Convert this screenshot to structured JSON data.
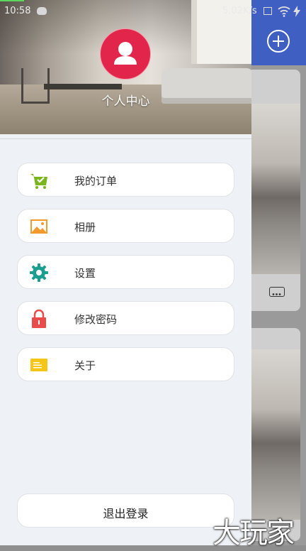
{
  "status_bar": {
    "time": "10:58",
    "network_speed": "5.02K/s",
    "icons": [
      "cat-icon",
      "sim-icon",
      "wifi-icon",
      "charging-icon"
    ]
  },
  "drawer": {
    "header": {
      "title": "个人中心",
      "avatar_icon": "user-icon",
      "avatar_color": "#e2264b"
    },
    "menu": [
      {
        "label": "我的订单",
        "icon": "cart-icon",
        "color": "#7ab51d"
      },
      {
        "label": "相册",
        "icon": "image-icon",
        "color": "#f29a2e"
      },
      {
        "label": "设置",
        "icon": "gear-icon",
        "color": "#1a9e8f"
      },
      {
        "label": "修改密码",
        "icon": "lock-icon",
        "color": "#e94b4b"
      },
      {
        "label": "关于",
        "icon": "note-icon",
        "color": "#f5c518"
      }
    ],
    "logout_label": "退出登录"
  },
  "background_app": {
    "topbar_color": "#3f5fc2",
    "add_icon": "add-circle-icon",
    "more_icon": "more-icon"
  },
  "watermark": "大玩家"
}
